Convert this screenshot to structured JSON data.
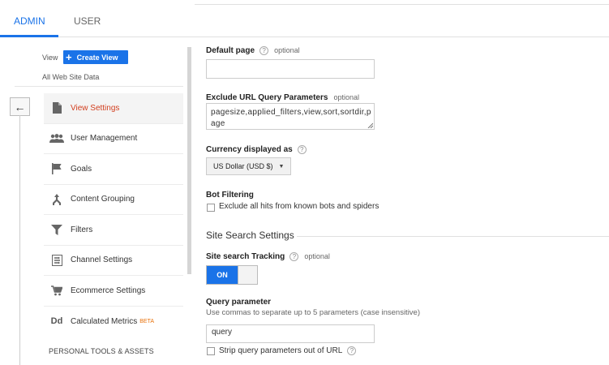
{
  "tabs": {
    "admin": "ADMIN",
    "user": "USER"
  },
  "sidebar": {
    "view_label": "View",
    "create_view": "Create View",
    "account": "All Web Site Data",
    "back_icon": "arrow-left-icon",
    "items": [
      {
        "label": "View Settings",
        "icon": "document-icon",
        "active": true
      },
      {
        "label": "User Management",
        "icon": "people-icon"
      },
      {
        "label": "Goals",
        "icon": "flag-icon"
      },
      {
        "label": "Content Grouping",
        "icon": "content-grouping-icon"
      },
      {
        "label": "Filters",
        "icon": "filter-icon"
      },
      {
        "label": "Channel Settings",
        "icon": "channel-settings-icon"
      },
      {
        "label": "Ecommerce Settings",
        "icon": "cart-icon"
      },
      {
        "label": "Calculated Metrics",
        "icon": "calculated-metrics-icon",
        "badge": "BETA",
        "icon_text": "Dd"
      }
    ],
    "section": "PERSONAL TOOLS & ASSETS"
  },
  "form": {
    "default_page": {
      "label": "Default page",
      "optional": "optional",
      "value": ""
    },
    "exclude_params": {
      "label": "Exclude URL Query Parameters",
      "optional": "optional",
      "value_line1": "pagesize,applied_filters,view,sort,sortdir,p",
      "value_line2": "age"
    },
    "currency": {
      "label": "Currency displayed as",
      "value": "US Dollar (USD $)"
    },
    "bot_filtering": {
      "label": "Bot Filtering",
      "checkbox": "Exclude all hits from known bots and spiders",
      "checked": false
    },
    "site_search": {
      "title": "Site Search Settings",
      "tracking_label": "Site search Tracking",
      "optional": "optional",
      "toggle": "ON",
      "query_label": "Query parameter",
      "query_hint": "Use commas to separate up to 5 parameters (case insensitive)",
      "query_value": "query",
      "strip_label": "Strip query parameters out of URL",
      "strip_checked": false
    }
  },
  "colors": {
    "accent": "#1a73e8",
    "active_nav": "#d23f1f",
    "beta": "#e8710a"
  }
}
